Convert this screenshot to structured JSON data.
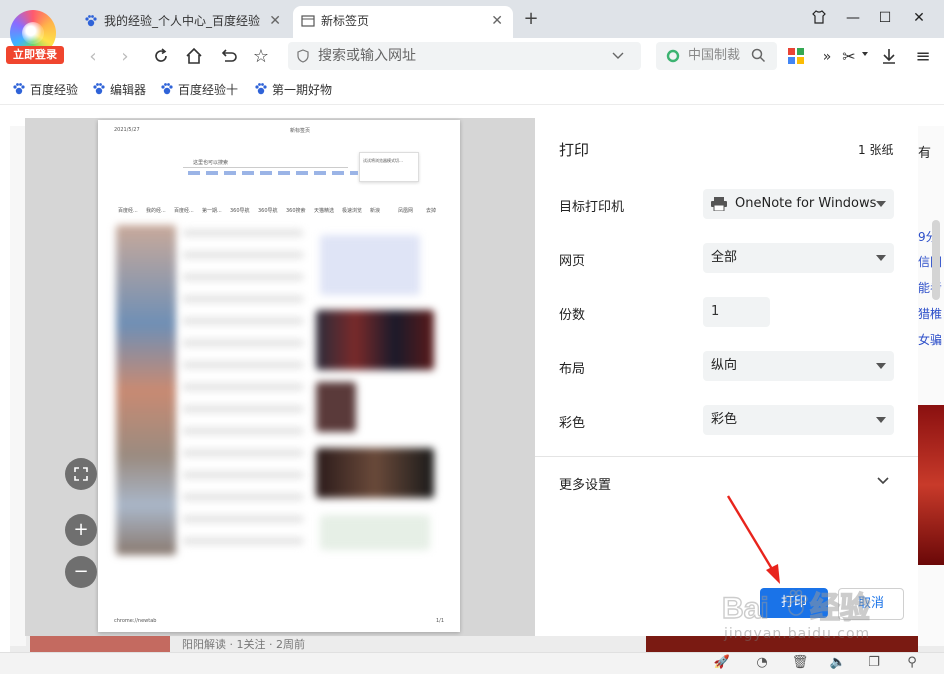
{
  "browser": {
    "login_label": "立即登录",
    "tabs": [
      {
        "title": "我的经验_个人中心_百度经验",
        "active": false
      },
      {
        "title": "新标签页",
        "active": true
      }
    ],
    "address_placeholder": "搜索或输入网址",
    "search_placeholder": "中国制裁",
    "bookmarks": [
      "百度经验",
      "编辑器",
      "百度经验十",
      "第一期好物"
    ]
  },
  "background_page": {
    "side_links": [
      "9分",
      "信网",
      "能考",
      "猎椎",
      "女骗"
    ],
    "side_text_top": "有",
    "bottom_text": "阳阳解读 · 1关注 · 2周前"
  },
  "preview": {
    "date": "2021/5/27",
    "page_title": "新标签页",
    "search_hint": "这里也可以搜索",
    "popup_text": "试试将浏览器模式切…",
    "footer_url": "chrome://newtab",
    "footer_page": "1/1",
    "nav_items": [
      "百度经...",
      "我的经...",
      "百度经...",
      "第一期...",
      "360导航",
      "360导航",
      "360搜索",
      "天猫精选",
      "极速浏览",
      "新浪",
      "凤凰网",
      "去掉"
    ]
  },
  "print_panel": {
    "title": "打印",
    "sheet_count": "1 张纸",
    "destination_label": "目标打印机",
    "destination_value": "OneNote for Windows",
    "pages_label": "网页",
    "pages_value": "全部",
    "copies_label": "份数",
    "copies_value": "1",
    "layout_label": "布局",
    "layout_value": "纵向",
    "color_label": "彩色",
    "color_value": "彩色",
    "more_settings_label": "更多设置",
    "print_button": "打印",
    "cancel_button": "取消"
  },
  "watermark": {
    "brand": "Baidu经验",
    "url": "jingyan.baidu.com"
  },
  "colors": {
    "accent": "#1a73e8",
    "arrow": "#e8241c",
    "login": "#f0452e"
  }
}
